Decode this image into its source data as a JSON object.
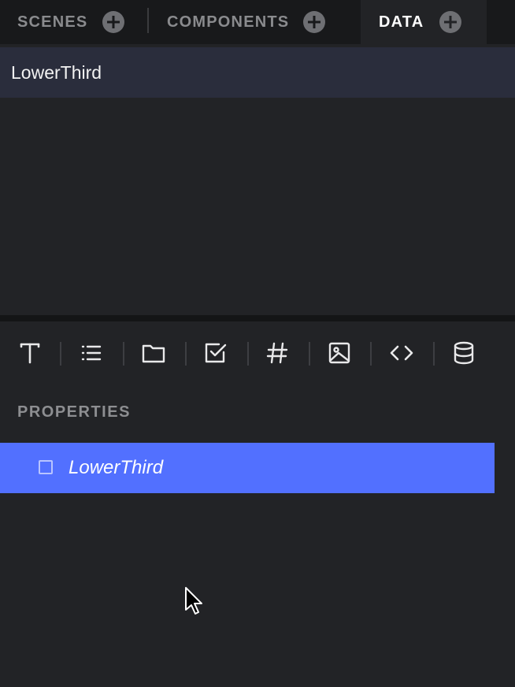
{
  "tabs": [
    {
      "label": "SCENES",
      "active": false
    },
    {
      "label": "COMPONENTS",
      "active": false
    },
    {
      "label": "DATA",
      "active": true
    }
  ],
  "scenes": {
    "items": [
      {
        "label": "LowerThird"
      }
    ]
  },
  "toolbar": {
    "tools": [
      {
        "icon": "text-type-icon"
      },
      {
        "icon": "list-icon"
      },
      {
        "icon": "folder-icon"
      },
      {
        "icon": "checkbox-icon"
      },
      {
        "icon": "hash-icon"
      },
      {
        "icon": "image-icon"
      },
      {
        "icon": "code-icon"
      },
      {
        "icon": "database-icon"
      }
    ]
  },
  "properties": {
    "title": "PROPERTIES",
    "items": [
      {
        "label": "LowerThird",
        "checked": false
      }
    ]
  },
  "colors": {
    "accent": "#5270ff",
    "background": "#222326",
    "tabbar": "#18191b"
  }
}
